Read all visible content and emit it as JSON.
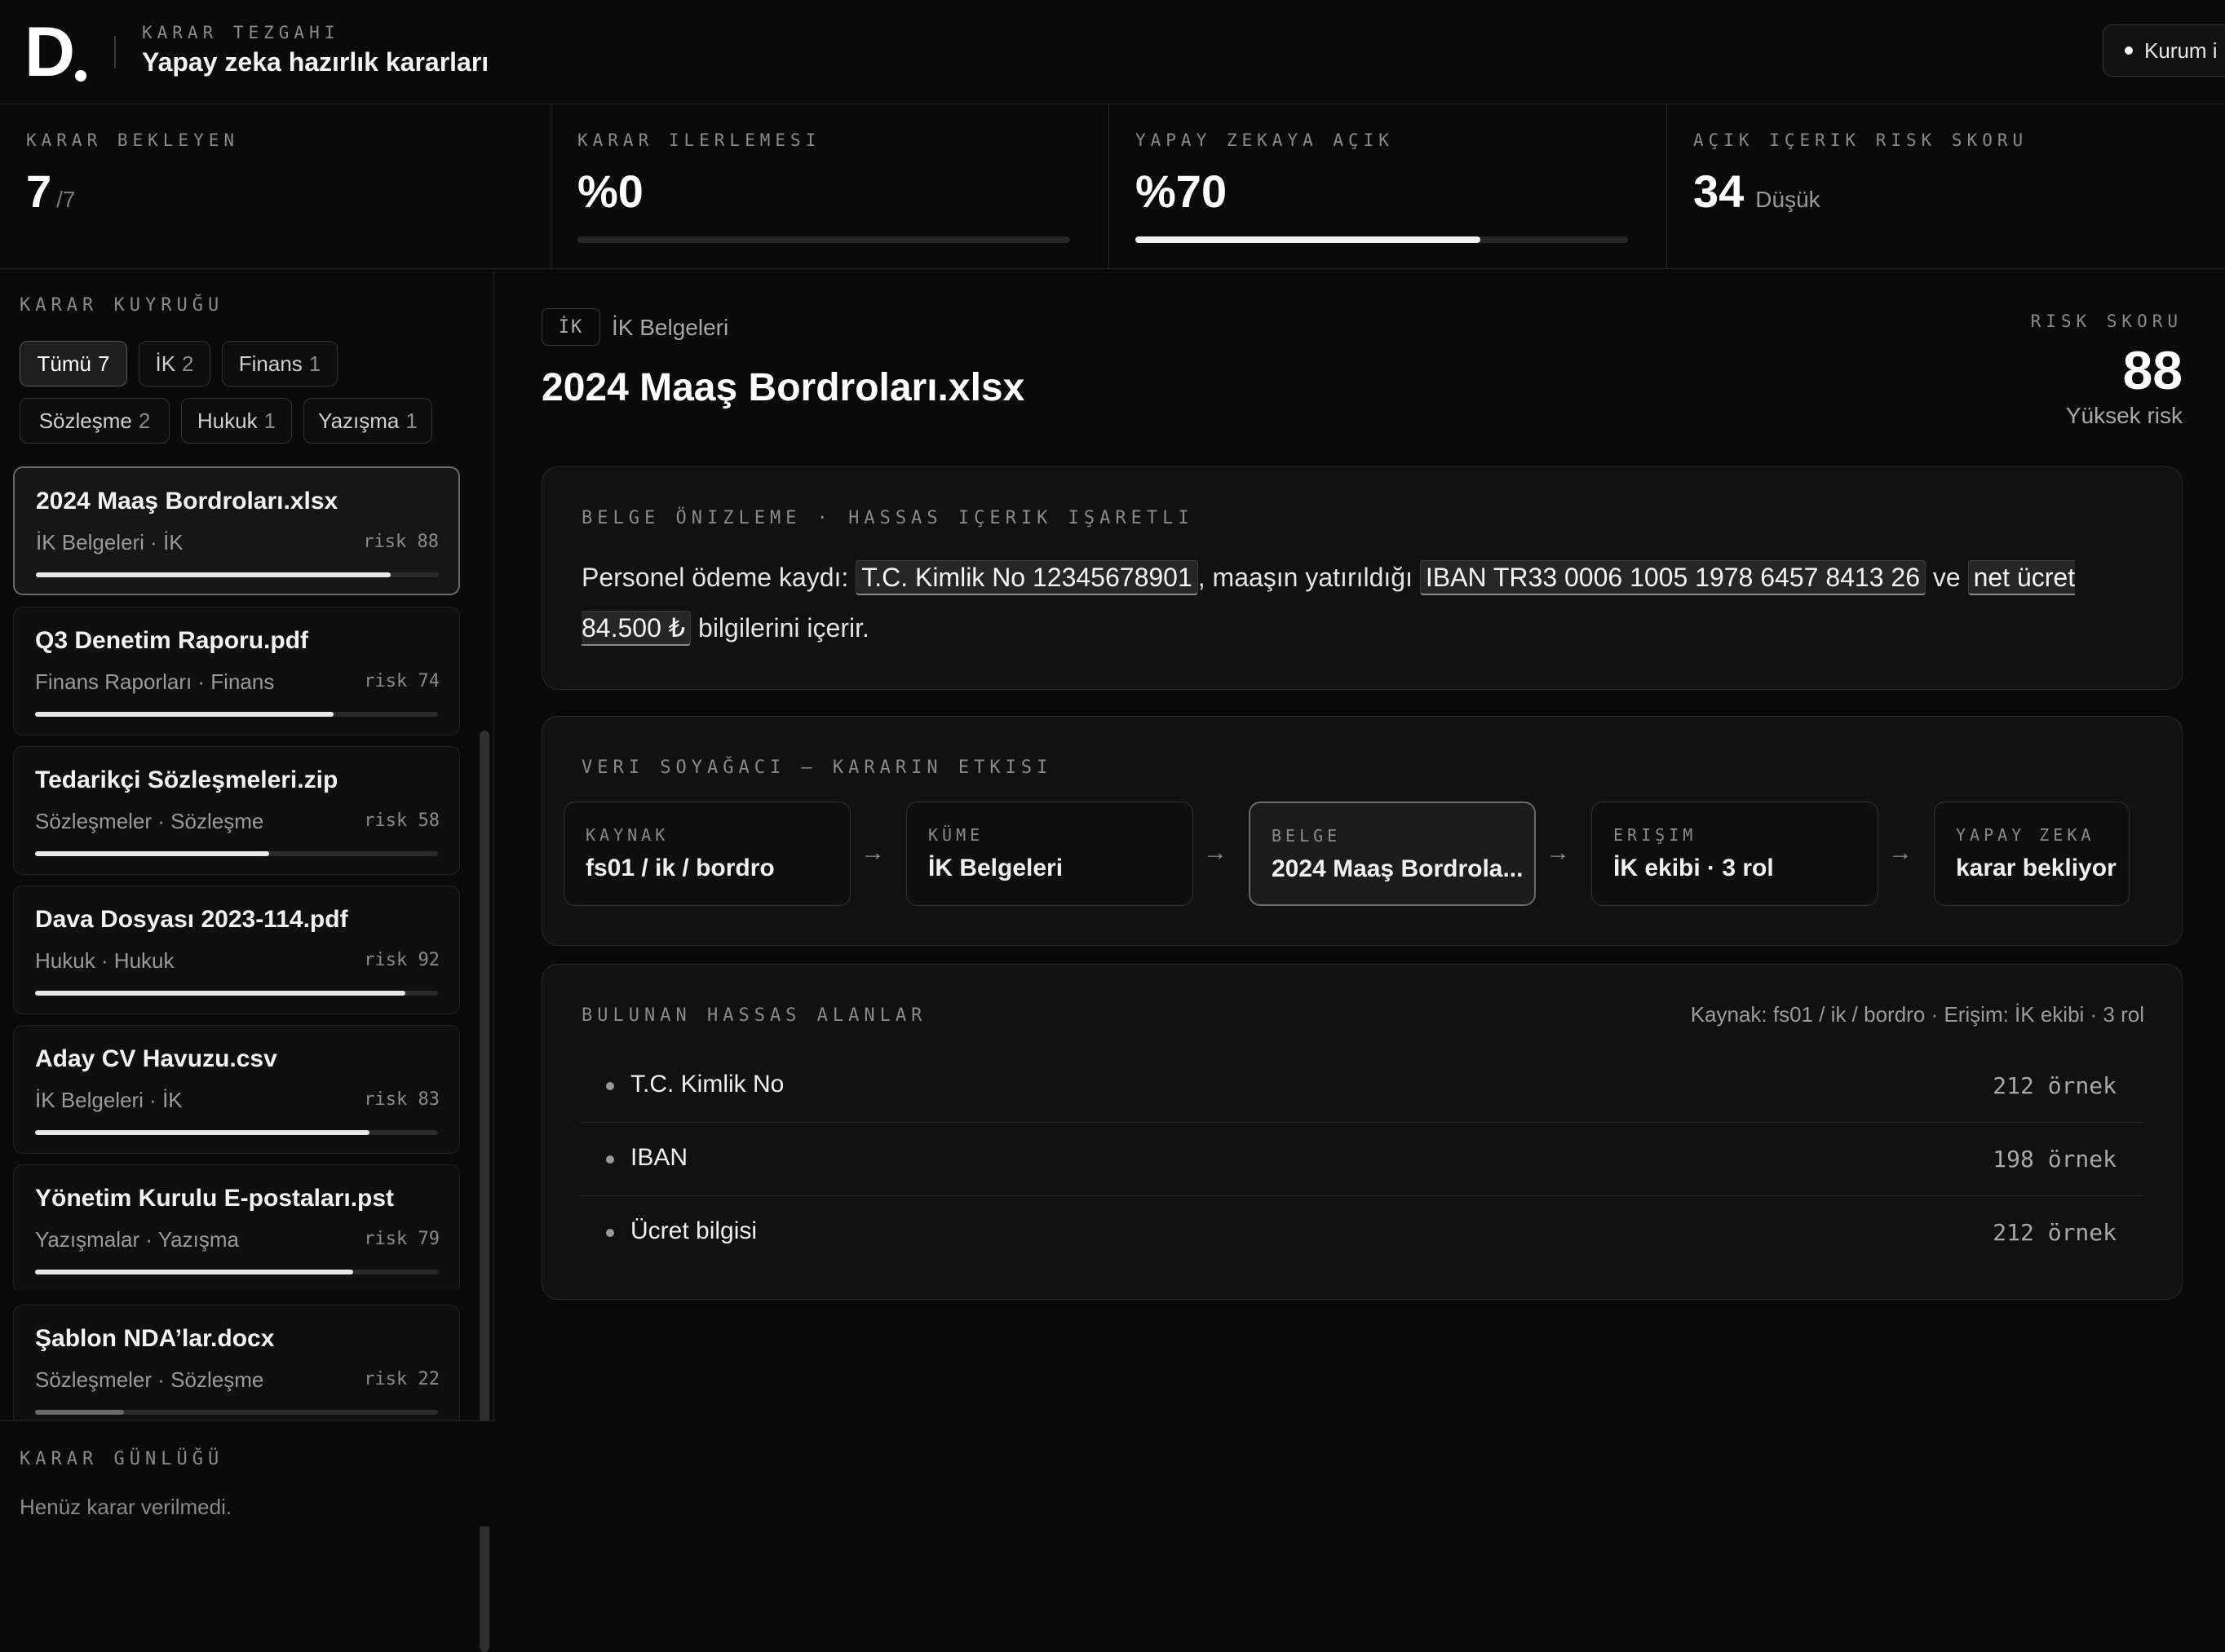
{
  "header": {
    "kicker": "KARAR TEZGAHI",
    "title": "Yapay zeka hazırlık kararları",
    "org_label": "Kurum i"
  },
  "stats": [
    {
      "label": "KARAR BEKLEYEN",
      "value": "7",
      "sub": "/7"
    },
    {
      "label": "KARAR ILERLEMESI",
      "value": "%0",
      "progress": 0
    },
    {
      "label": "YAPAY ZEKAYA AÇIK",
      "value": "%70",
      "progress": 0.7
    },
    {
      "label": "AÇIK IÇERIK RISK SKORU",
      "value": "34",
      "sub": "Düşük"
    }
  ],
  "sidebar": {
    "title": "KARAR KUYRUĞU",
    "filters": [
      {
        "label": "Tümü",
        "count": "7",
        "active": true
      },
      {
        "label": "İK",
        "count": "2"
      },
      {
        "label": "Finans",
        "count": "1"
      },
      {
        "label": "Sözleşme",
        "count": "2"
      },
      {
        "label": "Hukuk",
        "count": "1"
      },
      {
        "label": "Yazışma",
        "count": "1"
      }
    ],
    "items": [
      {
        "name": "2024 Maaş Bordroları.xlsx",
        "meta": "İK Belgeleri · İK",
        "risk_label": "risk 88",
        "risk": 88,
        "selected": true
      },
      {
        "name": "Q3 Denetim Raporu.pdf",
        "meta": "Finans Raporları · Finans",
        "risk_label": "risk 74",
        "risk": 74
      },
      {
        "name": "Tedarikçi Sözleşmeleri.zip",
        "meta": "Sözleşmeler · Sözleşme",
        "risk_label": "risk 58",
        "risk": 58
      },
      {
        "name": "Dava Dosyası 2023-114.pdf",
        "meta": "Hukuk · Hukuk",
        "risk_label": "risk 92",
        "risk": 92
      },
      {
        "name": "Aday CV Havuzu.csv",
        "meta": "İK Belgeleri · İK",
        "risk_label": "risk 83",
        "risk": 83
      },
      {
        "name": "Yönetim Kurulu E-postaları.pst",
        "meta": "Yazışmalar · Yazışma",
        "risk_label": "risk 79",
        "risk": 79
      },
      {
        "name": "Şablon NDA’lar.docx",
        "meta": "Sözleşmeler · Sözleşme",
        "risk_label": "risk 22",
        "risk": 22
      }
    ],
    "log_title": "KARAR GÜNLÜĞÜ",
    "log_empty": "Henüz karar verilmedi."
  },
  "main": {
    "category_badge": "İK",
    "category_label": "İK Belgeleri",
    "doc_title": "2024 Maaş Bordroları.xlsx",
    "risk_kicker": "RISK SKORU",
    "risk_value": "88",
    "risk_level": "Yüksek risk",
    "preview": {
      "title": "BELGE ÖNIZLEME · HASSAS IÇERIK IŞARETLI",
      "t1": "Personel ödeme kaydı: ",
      "h1": "T.C. Kimlik No 12345678901",
      "t2": ", maaşın yatırıldığı ",
      "h2": "IBAN TR33 0006 1005 1978 6457 8413 26",
      "t3": " ve ",
      "h3": "net ücret 84.500 ₺",
      "t4": " bilgilerini içerir."
    },
    "lineage": {
      "title": "VERI SOYAĞACI — KARARIN ETKISI",
      "arrow": "→",
      "nodes": [
        {
          "label": "KAYNAK",
          "value": "fs01 / ik / bordro"
        },
        {
          "label": "KÜME",
          "value": "İK Belgeleri"
        },
        {
          "label": "BELGE",
          "value": "2024 Maaş Bordrola...",
          "current": true
        },
        {
          "label": "ERIŞIM",
          "value": "İK ekibi · 3 rol"
        },
        {
          "label": "YAPAY ZEKA",
          "value": "karar bekliyor"
        }
      ]
    },
    "fields": {
      "title": "BULUNAN HASSAS ALANLAR",
      "source": "Kaynak: fs01 / ik / bordro · Erişim: İK ekibi · 3 rol",
      "rows": [
        {
          "name": "T.C. Kimlik No",
          "count": "212 örnek"
        },
        {
          "name": "IBAN",
          "count": "198 örnek"
        },
        {
          "name": "Ücret bilgisi",
          "count": "212 örnek"
        }
      ]
    }
  }
}
